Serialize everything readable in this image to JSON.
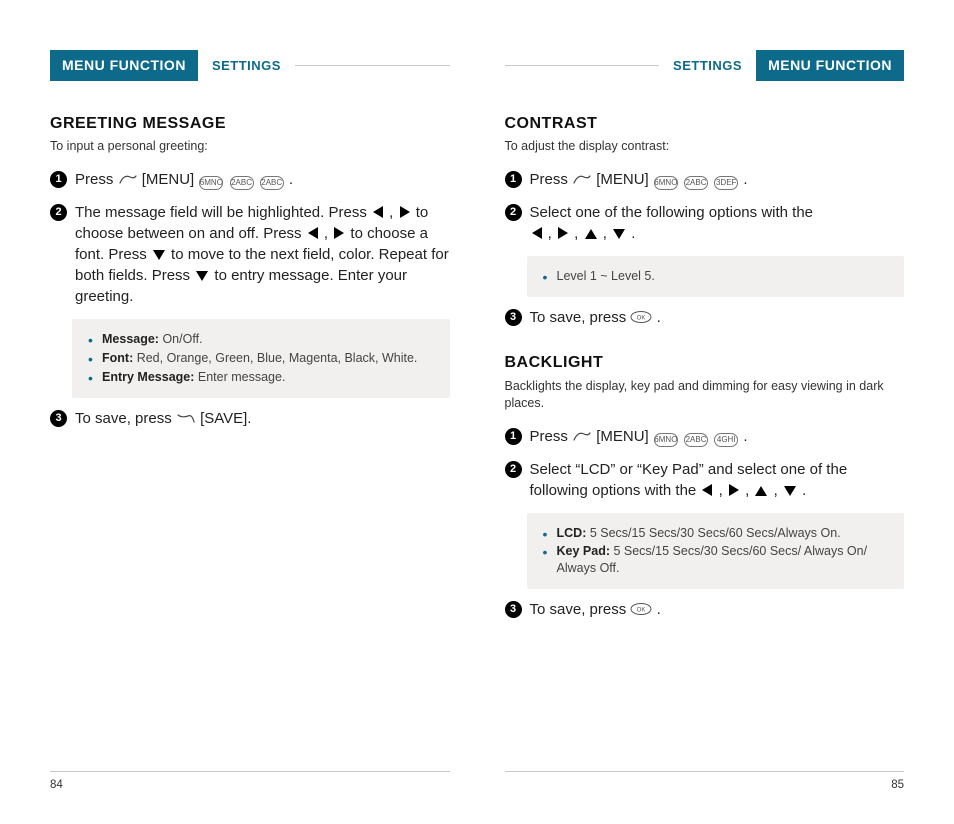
{
  "header": {
    "menu_function": "MENU FUNCTION",
    "settings": "SETTINGS"
  },
  "left": {
    "page_no": "84",
    "greeting": {
      "title": "GREETING MESSAGE",
      "intro": "To input a personal greeting:",
      "step1_a": "Press ",
      "step1_b": " [MENU] ",
      "keys": [
        "6MNO",
        "2ABC",
        "2ABC"
      ],
      "step2_a": "The message field will be highlighted. Press ",
      "step2_b": " to choose between on and off. Press ",
      "step2_c": " to choose a font. Press ",
      "step2_d": " to move to the next field, color. Repeat for both fields. Press ",
      "step2_e": " to entry message. Enter your greeting.",
      "bullets": [
        {
          "label": "Message:",
          "text": " On/Off."
        },
        {
          "label": "Font:",
          "text": " Red, Orange, Green, Blue, Magenta, Black, White."
        },
        {
          "label": "Entry Message:",
          "text": " Enter message."
        }
      ],
      "step3_a": "To save, press ",
      "step3_b": " [SAVE]."
    }
  },
  "right": {
    "page_no": "85",
    "contrast": {
      "title": "CONTRAST",
      "intro": "To adjust the display contrast:",
      "step1_a": "Press ",
      "step1_b": " [MENU] ",
      "keys": [
        "6MNO",
        "2ABC",
        "3DEF"
      ],
      "step2": "Select one of the following options with the ",
      "bullets": [
        {
          "label": "",
          "text": "Level 1 ~ Level 5."
        }
      ],
      "step3": "To save, press "
    },
    "backlight": {
      "title": "BACKLIGHT",
      "intro": "Backlights the display, key pad and dimming for easy viewing in dark places.",
      "step1_a": "Press ",
      "step1_b": " [MENU] ",
      "keys": [
        "6MNO",
        "2ABC",
        "4GHI"
      ],
      "step2_a": "Select “LCD” or “Key Pad” and select one of the following options with the ",
      "bullets": [
        {
          "label": "LCD:",
          "text": " 5 Secs/15 Secs/30 Secs/60 Secs/Always On."
        },
        {
          "label": "Key Pad:",
          "text": " 5 Secs/15 Secs/30 Secs/60 Secs/ Always On/ Always Off."
        }
      ],
      "step3": "To save, press "
    }
  }
}
